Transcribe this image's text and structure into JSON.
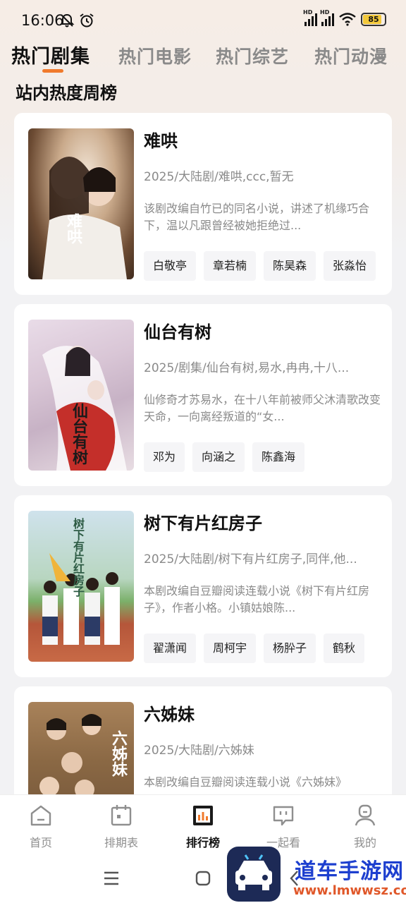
{
  "status": {
    "time": "16:06",
    "battery": "85",
    "icons": [
      "bell-off-icon",
      "alarm-icon",
      "hd-signal-icon",
      "hd-signal-icon",
      "wifi-icon",
      "battery-icon"
    ]
  },
  "tabs": [
    {
      "label": "热门剧集",
      "active": true
    },
    {
      "label": "热门电影",
      "active": false
    },
    {
      "label": "热门综艺",
      "active": false
    },
    {
      "label": "热门动漫",
      "active": false
    }
  ],
  "colors": {
    "accent": "#f07a2c",
    "active_text": "#111111",
    "muted_text": "#8a8a8a"
  },
  "section_title": "站内热度周榜",
  "items": [
    {
      "title": "难哄",
      "meta": "2025/大陆剧/难哄,ccc,暂无",
      "desc": "该剧改编自竹已的同名小说，讲述了机缘巧合下，温以凡跟曾经被她拒绝过...",
      "cast": [
        "白敬亭",
        "章若楠",
        "陈昊森",
        "张淼怡"
      ],
      "poster_text": "难哄"
    },
    {
      "title": "仙台有树",
      "meta": "2025/剧集/仙台有树,易水,冉冉,十八...",
      "desc": "仙修奇才苏易水，在十八年前被师父沐清歌改变天命，一向离经叛道的“女...",
      "cast": [
        "邓为",
        "向涵之",
        "陈鑫海"
      ],
      "poster_text": "仙台有树"
    },
    {
      "title": "树下有片红房子",
      "meta": "2025/大陆剧/树下有片红房子,同伴,他...",
      "desc": "本剧改编自豆瓣阅读连载小说《树下有片红房子》，作者小格。小镇姑娘陈...",
      "cast": [
        "翟潇闻",
        "周柯宇",
        "杨肸子",
        "鹤秋"
      ],
      "poster_text": "树下有片红房子"
    },
    {
      "title": "六姊妹",
      "meta": "2025/大陆剧/六姊妹",
      "desc": "本剧改编自豆瓣阅读连载小说《六姊妹》",
      "cast": [],
      "poster_text": "六姊妹"
    }
  ],
  "nav": [
    {
      "label": "首页",
      "icon": "home-icon",
      "active": false
    },
    {
      "label": "排期表",
      "icon": "calendar-icon",
      "active": false
    },
    {
      "label": "排行榜",
      "icon": "ranking-icon",
      "active": true
    },
    {
      "label": "一起看",
      "icon": "chat-icon",
      "active": false
    },
    {
      "label": "我的",
      "icon": "profile-icon",
      "active": false
    }
  ],
  "watermark": {
    "name": "道车手游网",
    "url": "www.lmwwsz.com"
  }
}
